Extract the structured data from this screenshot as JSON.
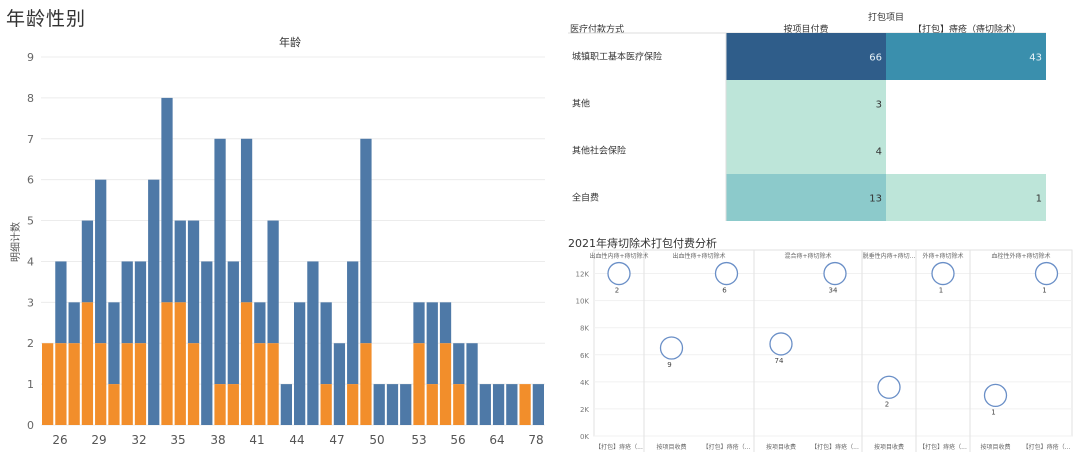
{
  "page_title": "年龄性别",
  "chart_data": [
    {
      "type": "bar",
      "title": "年龄",
      "ylabel": "明细计数",
      "ylim": [
        0,
        9
      ],
      "yticks": [
        0,
        1,
        2,
        3,
        4,
        5,
        6,
        7,
        8,
        9
      ],
      "x_tick_labels": [
        "26",
        "29",
        "32",
        "35",
        "38",
        "41",
        "44",
        "47",
        "50",
        "53",
        "56",
        "58",
        "64",
        "78"
      ],
      "colors": {
        "male": "#4e79a7",
        "female": "#f28e2b"
      },
      "totals": [
        2,
        4,
        3,
        5,
        6,
        3,
        4,
        4,
        6,
        8,
        5,
        5,
        4,
        7,
        4,
        7,
        3,
        5,
        1,
        3,
        4,
        3,
        2,
        4,
        7,
        1,
        1,
        1,
        3,
        3,
        3,
        2,
        2,
        1,
        1,
        1,
        1,
        1
      ],
      "female": [
        2,
        2,
        2,
        3,
        2,
        1,
        2,
        2,
        0,
        3,
        3,
        2,
        0,
        1,
        1,
        3,
        2,
        2,
        0,
        0,
        0,
        1,
        0,
        1,
        2,
        0,
        0,
        0,
        2,
        1,
        2,
        1,
        0,
        0,
        0,
        0,
        1,
        0
      ]
    },
    {
      "type": "table",
      "title": "打包项目",
      "row_header": "医疗付款方式",
      "columns": [
        "按项目付费",
        "【打包】痔疮（痔切除术）"
      ],
      "rows": [
        {
          "label": "城镇职工基本医疗保险",
          "values": [
            66,
            43
          ]
        },
        {
          "label": "其他",
          "values": [
            3,
            null
          ]
        },
        {
          "label": "其他社会保险",
          "values": [
            4,
            null
          ]
        },
        {
          "label": "全自费",
          "values": [
            13,
            1
          ]
        }
      ]
    },
    {
      "type": "scatter",
      "title": "2021年痔切除术打包付费分析",
      "yticks": [
        "0K",
        "2K",
        "4K",
        "6K",
        "8K",
        "10K",
        "12K"
      ],
      "ylim": [
        0,
        13000
      ],
      "panels": [
        {
          "header": "出血性内痔+痔切除术",
          "x_labels": [
            "【打包】痔疮（..."
          ],
          "points": [
            {
              "col": 0,
              "y": 12000,
              "label": "2"
            }
          ]
        },
        {
          "header": "出血性痔+痔切除术",
          "x_labels": [
            "按项目收费",
            "【打包】痔疮（..."
          ],
          "points": [
            {
              "col": 0,
              "y": 6500,
              "label": "9"
            },
            {
              "col": 1,
              "y": 12000,
              "label": "6"
            }
          ]
        },
        {
          "header": "混合痔+痔切除术",
          "x_labels": [
            "按项目收费",
            "【打包】痔疮（..."
          ],
          "points": [
            {
              "col": 0,
              "y": 6800,
              "label": "74"
            },
            {
              "col": 1,
              "y": 12000,
              "label": "34"
            }
          ]
        },
        {
          "header": "脱垂性内痔+痔切...",
          "x_labels": [
            "按项目收费"
          ],
          "points": [
            {
              "col": 0,
              "y": 3600,
              "label": "2"
            }
          ]
        },
        {
          "header": "外痔+痔切除术",
          "x_labels": [
            "【打包】痔疮（..."
          ],
          "points": [
            {
              "col": 0,
              "y": 12000,
              "label": "1"
            }
          ]
        },
        {
          "header": "血栓性外痔+痔切除术",
          "x_labels": [
            "按项目收费",
            "【打包】痔疮（..."
          ],
          "points": [
            {
              "col": 0,
              "y": 3000,
              "label": "1"
            },
            {
              "col": 1,
              "y": 12000,
              "label": "1"
            }
          ]
        }
      ]
    }
  ]
}
